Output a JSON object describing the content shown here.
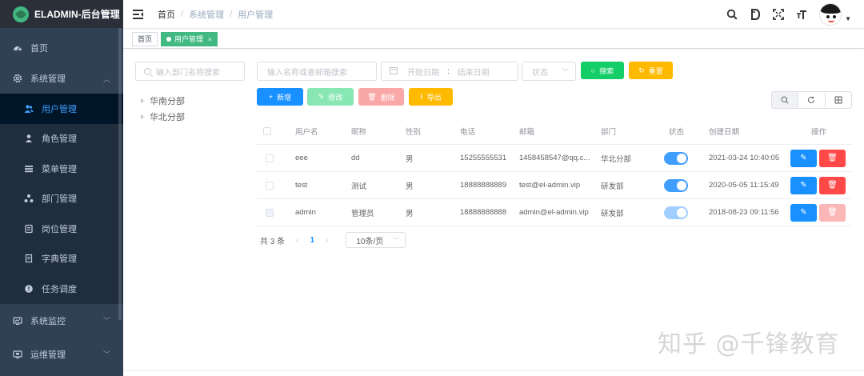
{
  "app": {
    "title": "ELADMIN-后台管理"
  },
  "sidebar": {
    "items": [
      {
        "label": "首页",
        "icon": "dashboard-icon"
      },
      {
        "label": "系统管理",
        "icon": "gear-icon",
        "expanded": true
      },
      {
        "label": "系统监控",
        "icon": "monitor-icon"
      },
      {
        "label": "运维管理",
        "icon": "server-icon"
      }
    ],
    "system_children": [
      {
        "label": "用户管理",
        "icon": "users-icon",
        "active": true
      },
      {
        "label": "角色管理",
        "icon": "role-icon"
      },
      {
        "label": "菜单管理",
        "icon": "menu-icon"
      },
      {
        "label": "部门管理",
        "icon": "dept-icon"
      },
      {
        "label": "岗位管理",
        "icon": "post-icon"
      },
      {
        "label": "字典管理",
        "icon": "dict-icon"
      },
      {
        "label": "任务调度",
        "icon": "timer-icon"
      }
    ]
  },
  "breadcrumb": [
    "首页",
    "系统管理",
    "用户管理"
  ],
  "tags": [
    {
      "label": "首页"
    },
    {
      "label": "用户管理",
      "close": "×",
      "active": true
    }
  ],
  "dept_search": {
    "placeholder": "输入部门名称搜索"
  },
  "dept_tree": [
    "华南分部",
    "华北分部"
  ],
  "filters": {
    "keyword_placeholder": "输入名称或者邮箱搜索",
    "start_date": "开始日期",
    "date_sep": ":",
    "end_date": "结束日期",
    "status_placeholder": "状态",
    "search_label": "搜索",
    "reset_label": "重置"
  },
  "toolbar": {
    "add_label": "新增",
    "edit_label": "修改",
    "delete_label": "删除",
    "export_label": "导出"
  },
  "table": {
    "headers": [
      "用户名",
      "昵称",
      "性别",
      "电话",
      "邮箱",
      "部门",
      "状态",
      "创建日期",
      "操作"
    ],
    "rows": [
      {
        "username": "eee",
        "nickname": "dd",
        "gender": "男",
        "phone": "15255555531",
        "email": "1458458547@qq.c...",
        "dept": "华北分部",
        "enabled": true,
        "created": "2021-03-24 10:40:05"
      },
      {
        "username": "test",
        "nickname": "测试",
        "gender": "男",
        "phone": "18888888889",
        "email": "test@el-admin.vip",
        "dept": "研发部",
        "enabled": true,
        "created": "2020-05-05 11:15:49"
      },
      {
        "username": "admin",
        "nickname": "管理员",
        "gender": "男",
        "phone": "18888888888",
        "email": "admin@el-admin.vip",
        "dept": "研发部",
        "enabled": true,
        "created": "2018-08-23 09:11:56"
      }
    ]
  },
  "pagination": {
    "total_text": "共 3 条",
    "current_page": "1",
    "page_size": "10条/页",
    "prev": "‹",
    "next": "›"
  },
  "watermark": "知乎 @千锋教育",
  "colors": {
    "sidebar_bg": "#304156",
    "accent": "#409eff",
    "success": "#13ce66",
    "warning": "#ffba00",
    "danger": "#ff4949",
    "tag_active": "#42b983"
  }
}
